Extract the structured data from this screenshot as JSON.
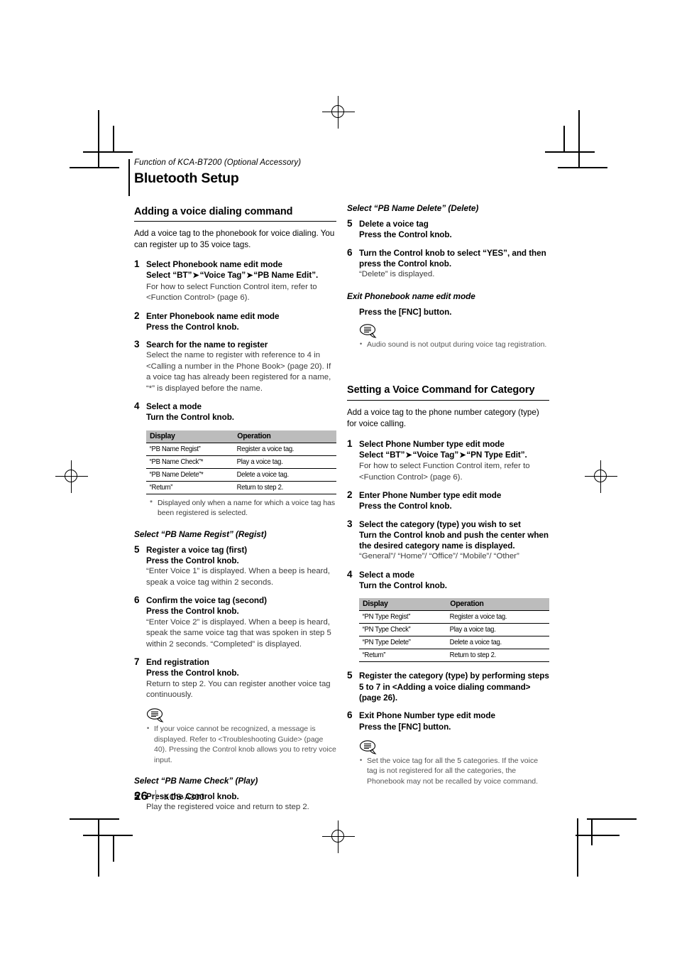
{
  "header": {
    "kicker": "Function of KCA-BT200 (Optional Accessory)",
    "title": "Bluetooth Setup"
  },
  "left_column": {
    "section_title": "Adding a voice dialing command",
    "intro": "Add a voice tag to the phonebook for voice dialing. You can register up to 35 voice tags.",
    "steps": [
      {
        "num": "1",
        "bold1": "Select Phonebook name edit mode",
        "bold2_pre": "Select “BT”",
        "bold2_mid": "“Voice Tag”",
        "bold2_post": "“PB Name Edit”.",
        "plain": "For how to select Function Control item, refer to <Function Control> (page 6)."
      },
      {
        "num": "2",
        "bold1": "Enter Phonebook name edit mode",
        "bold2": "Press the Control knob."
      },
      {
        "num": "3",
        "bold1": "Search for the name to register",
        "plain": "Select the name to register with reference to 4 in <Calling a number in the Phone Book> (page 20). If a voice tag has already been registered for a name, “*” is displayed before the name."
      },
      {
        "num": "4",
        "bold1": "Select a mode",
        "bold2": "Turn the Control knob."
      }
    ],
    "table": {
      "headers": [
        "Display",
        "Operation"
      ],
      "rows": [
        [
          "“PB Name Regist”",
          "Register a voice tag."
        ],
        [
          "“PB Name Check”*",
          "Play a voice tag."
        ],
        [
          "“PB Name Delete”*",
          "Delete a voice tag."
        ],
        [
          "“Return”",
          "Return to step 2."
        ]
      ]
    },
    "footnote_marker": "*",
    "footnote": "Displayed only when a name for which a voice tag has been registered is selected.",
    "sub_regist": "Select “PB Name Regist” (Regist)",
    "steps_regist": [
      {
        "num": "5",
        "bold1": "Register a voice tag (first)",
        "bold2": "Press the Control knob.",
        "plain": "“Enter Voice 1” is displayed. When a beep is heard, speak a voice tag within 2 seconds."
      },
      {
        "num": "6",
        "bold1": "Confirm the voice tag (second)",
        "bold2": "Press the Control knob.",
        "plain": "“Enter Voice 2” is displayed. When a beep is heard, speak the same voice tag that was spoken in step 5 within 2 seconds. “Completed” is displayed."
      },
      {
        "num": "7",
        "bold1": "End registration",
        "bold2": "Press the Control knob.",
        "plain": "Return to step 2. You can register another voice tag continuously."
      }
    ],
    "note_icon": "note-speech-bubble-icon",
    "note_items": [
      "If your voice cannot be recognized, a message is displayed. Refer to <Troubleshooting Guide> (page 40). Pressing the Control knob allows you to retry voice input."
    ],
    "sub_check": "Select “PB Name Check” (Play)",
    "steps_check": [
      {
        "num": "5",
        "bold1": "Press the Control knob.",
        "plain": "Play the registered voice and return to step 2."
      }
    ]
  },
  "right_column": {
    "sub_delete": "Select “PB Name Delete” (Delete)",
    "steps_delete": [
      {
        "num": "5",
        "bold1": "Delete a voice tag",
        "bold2": "Press the Control knob."
      },
      {
        "num": "6",
        "bold1": "Turn the Control knob to select “YES”, and then press the Control knob.",
        "plain": "“Delete” is displayed."
      }
    ],
    "sub_exit": "Exit Phonebook name edit mode",
    "exit_action": "Press the [FNC] button.",
    "note_icon": "note-speech-bubble-icon",
    "note_items": [
      "Audio sound is not output during voice tag registration."
    ],
    "section_title": "Setting a Voice Command for Category",
    "intro": "Add a voice tag to the phone number category (type) for voice calling.",
    "steps": [
      {
        "num": "1",
        "bold1": "Select Phone Number type edit mode",
        "bold2_pre": "Select “BT”",
        "bold2_mid": "“Voice Tag”",
        "bold2_post": "“PN Type Edit”.",
        "plain": "For how to select Function Control item, refer to <Function Control> (page 6)."
      },
      {
        "num": "2",
        "bold1": "Enter Phone Number type edit mode",
        "bold2": "Press the Control knob."
      },
      {
        "num": "3",
        "bold1": "Select the category (type) you wish to set",
        "bold2": "Turn the Control knob and push the center when the desired category name is displayed.",
        "plain": "“General”/ “Home”/ “Office”/ “Mobile”/ “Other”"
      },
      {
        "num": "4",
        "bold1": "Select a mode",
        "bold2": "Turn the Control knob."
      }
    ],
    "table": {
      "headers": [
        "Display",
        "Operation"
      ],
      "rows": [
        [
          "“PN Type Regist”",
          "Register a voice tag."
        ],
        [
          "“PN Type Check”",
          "Play a voice tag."
        ],
        [
          "“PN Type Delete”",
          "Delete a voice tag."
        ],
        [
          "“Return”",
          "Return to step 2."
        ]
      ]
    },
    "steps_after": [
      {
        "num": "5",
        "bold1": "Register the category (type) by performing steps 5 to 7 in <Adding a voice dialing command> (page 26)."
      },
      {
        "num": "6",
        "bold1": "Exit Phone Number type edit mode",
        "bold2": "Press the [FNC] button."
      }
    ],
    "note2_icon": "note-speech-bubble-icon",
    "note2_items": [
      "Set the voice tag for all the 5 categories.  If the voice tag is not registered for all the categories, the Phonebook may not be recalled by voice command."
    ]
  },
  "footer": {
    "page_number": "26",
    "model": "KOS-A300"
  },
  "glyphs": {
    "arrow": "➤"
  }
}
